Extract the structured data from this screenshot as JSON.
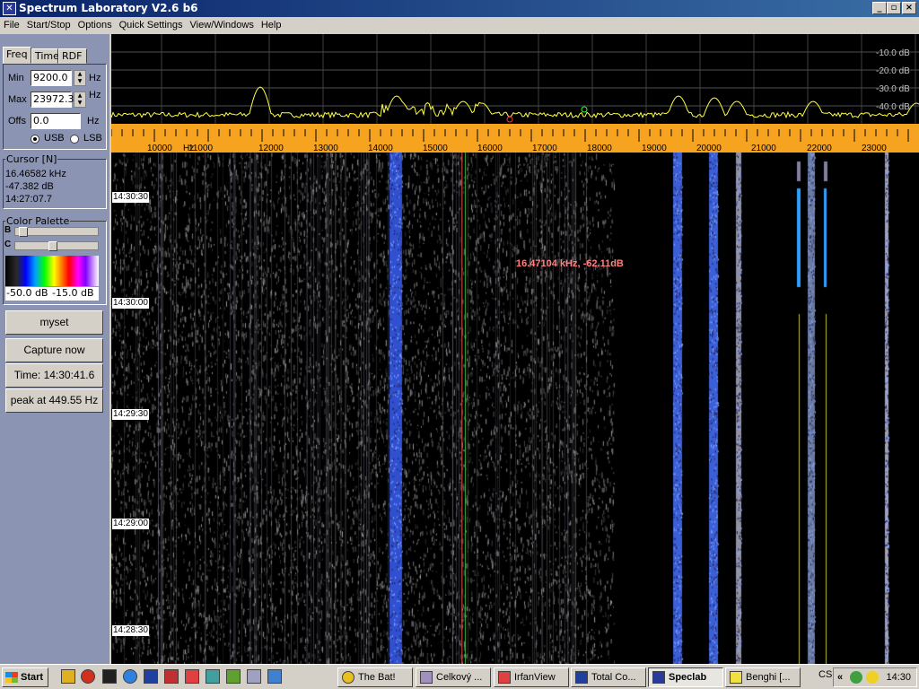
{
  "window": {
    "title": "Spectrum Laboratory V2.6 b6",
    "icon": "speclab-icon"
  },
  "menu": [
    "File",
    "Start/Stop",
    "Options",
    "Quick Settings",
    "View/Windows",
    "Help"
  ],
  "panel": {
    "tabs": [
      "Freq",
      "Time",
      "RDF"
    ],
    "active_tab": "Freq",
    "min_label": "Min",
    "min_value": "9200.0",
    "max_label": "Max",
    "max_value": "23972.3",
    "offs_label": "Offs",
    "offs_value": "0.0",
    "unit": "Hz",
    "usb_label": "USB",
    "lsb_label": "LSB",
    "sideband": "USB",
    "cursor_title": "Cursor [N]",
    "cursor_freq": "16.46582 kHz",
    "cursor_level": "-47.382 dB",
    "cursor_time": "14:27:07.7",
    "palette_title": "Color Palette",
    "b_label": "B",
    "c_label": "C",
    "b_position": 0.05,
    "c_position": 0.45,
    "scale_min": "-50.0 dB",
    "scale_max": "-15.0 dB",
    "btn_myset": "myset",
    "btn_capture": "Capture now",
    "btn_time": "Time:  14:30:41.6",
    "btn_peak": "peak at 449.55 Hz"
  },
  "spectrum": {
    "db_labels": [
      "-10.0 dB",
      "-20.0 dB",
      "-30.0 dB",
      "-40.0 dB"
    ],
    "freq_ticks": [
      "10000",
      "Hz",
      "11000",
      "12000",
      "13000",
      "14000",
      "15000",
      "16000",
      "17000",
      "18000",
      "19000",
      "20000",
      "21000",
      "22000",
      "23000"
    ],
    "trace_color": "#ffff40",
    "axis_color": "#f6a420"
  },
  "waterfall": {
    "timestamps": [
      "14:30:30",
      "14:30:00",
      "14:29:30",
      "14:29:00",
      "14:28:30"
    ],
    "cursor_readout": "16.47104 kHz, -62.11dB"
  },
  "taskbar": {
    "start_label": "Start",
    "tasks": [
      "The Bat!",
      "Celkový ...",
      "IrfanView",
      "Total Co...",
      "Speclab",
      "Benghi [..."
    ],
    "active_task": "Speclab",
    "tray_text": "CS",
    "clock": "14:30"
  }
}
